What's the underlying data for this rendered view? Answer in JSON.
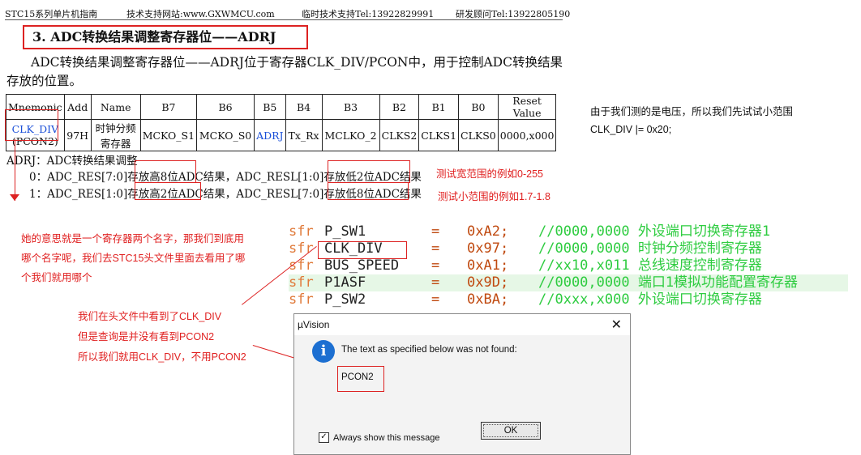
{
  "header": {
    "book": "STC15系列单片机指南",
    "website": "技术支持网站:www.GXWMCU.com",
    "support": "临时技术支持Tel:13922829991",
    "consultant": "研发顾问Tel:13922805190"
  },
  "section_title": "3. ADC转换结果调整寄存器位——ADRJ",
  "intro_paragraph": "ADC转换结果调整寄存器位——ADRJ位于寄存器CLK_DIV/PCON中，用于控制ADC转换结果存放的位置。",
  "register_table": {
    "headers": [
      "Mnemonic",
      "Add",
      "Name",
      "B7",
      "B6",
      "B5",
      "B4",
      "B3",
      "B2",
      "B1",
      "B0",
      "Reset Value"
    ],
    "row": {
      "mnemonic_1": "CLK_DIV",
      "mnemonic_2": "(PCON2)",
      "add": "97H",
      "name_1": "时钟分频",
      "name_2": "寄存器",
      "b7": "MCKO_S1",
      "b6": "MCKO_S0",
      "b5": "ADRJ",
      "b4": "Tx_Rx",
      "b3": "MCLKO_2",
      "b2": "CLKS2",
      "b1": "CLKS1",
      "b0": "CLKS0",
      "reset": "0000,x000"
    }
  },
  "adrj": {
    "title": "ADRJ：ADC转换结果调整",
    "line0": "0：ADC_RES[7:0]存放高8位ADC结果，ADC_RESL[1:0]存放低2位ADC结果",
    "line1": "1：ADC_RES[1:0]存放高2位ADC结果，ADC_RESL[7:0]存放低8位ADC结果"
  },
  "annotations": {
    "wide_range": "测试宽范围的例如0-255",
    "narrow_range": "测试小范围的例如1.7-1.8",
    "name_question": [
      "她的意思就是一个寄存器两个名字，那我们到底用",
      "哪个名字呢，我们去STC15头文件里面去看用了哪",
      "个我们就用哪个"
    ],
    "header_finding": [
      "我们在头文件中看到了CLK_DIV",
      "但是查询是并没有看到PCON2",
      "所以我们就用CLK_DIV，不用PCON2"
    ],
    "side_note_1": "由于我们测的是电压，所以我们先试试小范围",
    "side_note_2": "CLK_DIV |= 0x20;"
  },
  "code_lines": [
    {
      "kw": "sfr",
      "name": "P_SW1",
      "eq": "=",
      "val": "0xA2;",
      "comment": "//0000,0000 外设端口切换寄存器1"
    },
    {
      "kw": "sfr",
      "name": "CLK_DIV",
      "eq": "=",
      "val": "0x97;",
      "comment": "//0000,0000 时钟分频控制寄存器"
    },
    {
      "kw": "sfr",
      "name": "BUS_SPEED",
      "eq": "=",
      "val": "0xA1;",
      "comment": "//xx10,x011 总线速度控制寄存器"
    },
    {
      "kw": "sfr",
      "name": "P1ASF",
      "eq": "=",
      "val": "0x9D;",
      "comment": "//0000,0000 端口1模拟功能配置寄存器"
    },
    {
      "kw": "sfr",
      "name": "P_SW2",
      "eq": "=",
      "val": "0xBA;",
      "comment": "//0xxx,x000 外设端口切换寄存器"
    }
  ],
  "dialog": {
    "title": "µVision",
    "message": "The text as specified below was not found:",
    "search_text": "PCON2",
    "checkbox_label": "Always show this message",
    "checkbox_mark": "✓",
    "ok_label": "OK",
    "close_glyph": "✕",
    "info_glyph": "i"
  },
  "colors": {
    "annotation_red": "#e02020",
    "highlight_blue": "#1a4fd8",
    "comment_green": "#2ecc40",
    "keyword_orange": "#e07a3a"
  }
}
